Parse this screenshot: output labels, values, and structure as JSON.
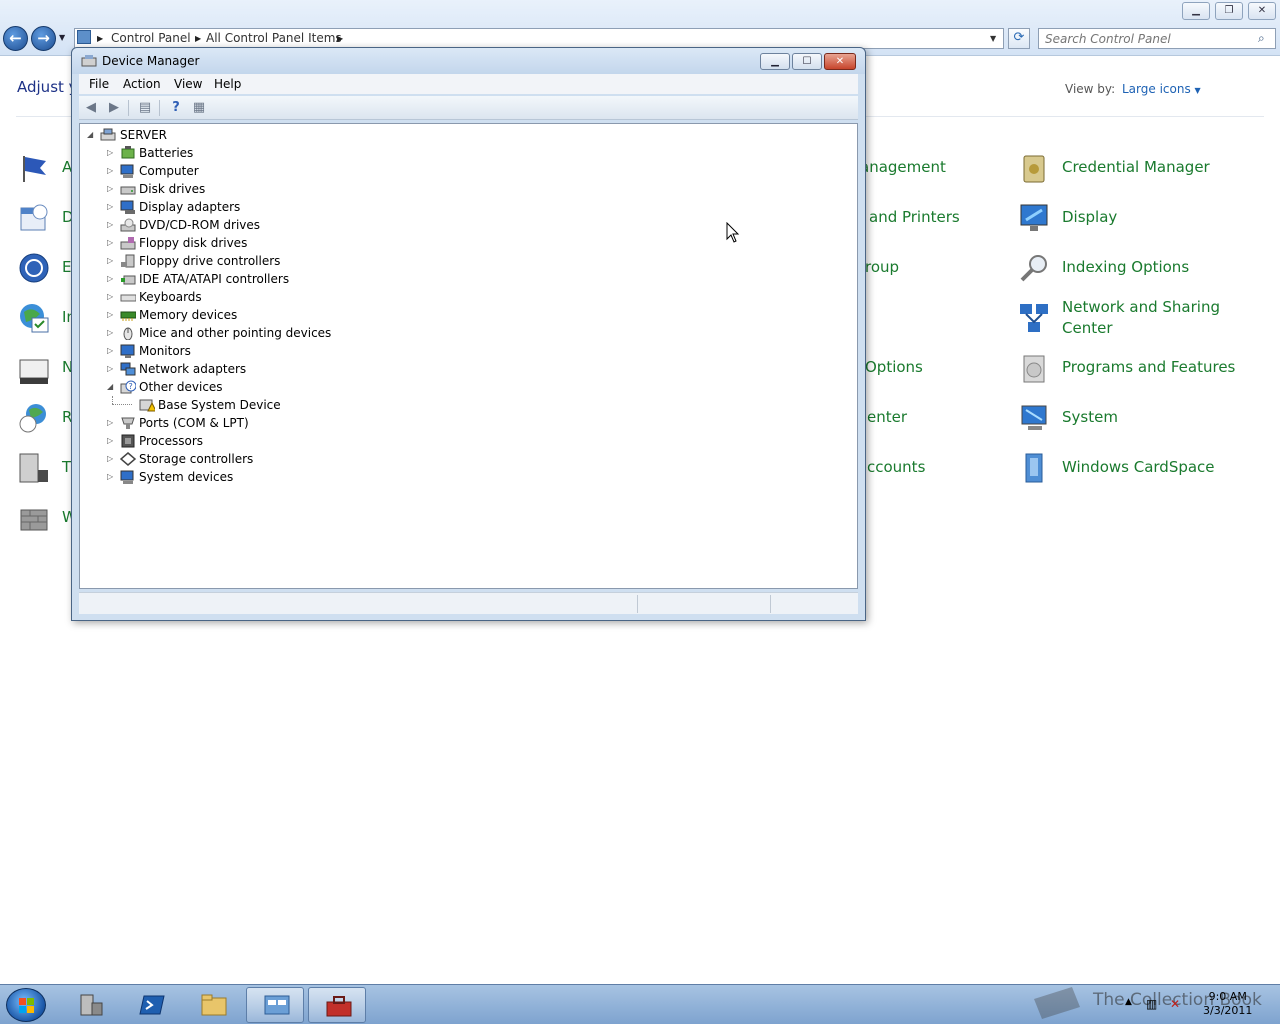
{
  "control_panel": {
    "breadcrumb": [
      "Control Panel",
      "All Control Panel Items"
    ],
    "search_placeholder": "Search Control Panel",
    "heading_partial": "Adjust y",
    "view_by_label": "View by:",
    "view_by_value": "Large icons",
    "left_column_partial": [
      "A",
      "D",
      "E",
      "In",
      "N",
      "R",
      "T",
      "W"
    ],
    "middle_column_partial": [
      "anagement",
      "and Printers",
      "roup",
      "Options",
      "enter",
      "ccounts"
    ],
    "right_column": [
      "Credential Manager",
      "Display",
      "Indexing Options",
      "Network and Sharing",
      "Center",
      "Programs and Features",
      "System",
      "Windows CardSpace"
    ]
  },
  "device_manager": {
    "title": "Device Manager",
    "menu": [
      "File",
      "Action",
      "View",
      "Help"
    ],
    "tree": {
      "root": "SERVER",
      "items": [
        "Batteries",
        "Computer",
        "Disk drives",
        "Display adapters",
        "DVD/CD-ROM drives",
        "Floppy disk drives",
        "Floppy drive controllers",
        "IDE ATA/ATAPI controllers",
        "Keyboards",
        "Memory devices",
        "Mice and other pointing devices",
        "Monitors",
        "Network adapters",
        "Other devices",
        "Base System Device",
        "Ports (COM & LPT)",
        "Processors",
        "Storage controllers",
        "System devices"
      ]
    }
  },
  "taskbar": {
    "clock_time": "9:0 AM",
    "clock_date": "3/3/2011",
    "watermark": "The Collection Book"
  },
  "colors": {
    "cp_link_green": "#1a7a2e",
    "cp_heading_blue": "#1e3287",
    "accent_blue": "#1e62b4"
  }
}
